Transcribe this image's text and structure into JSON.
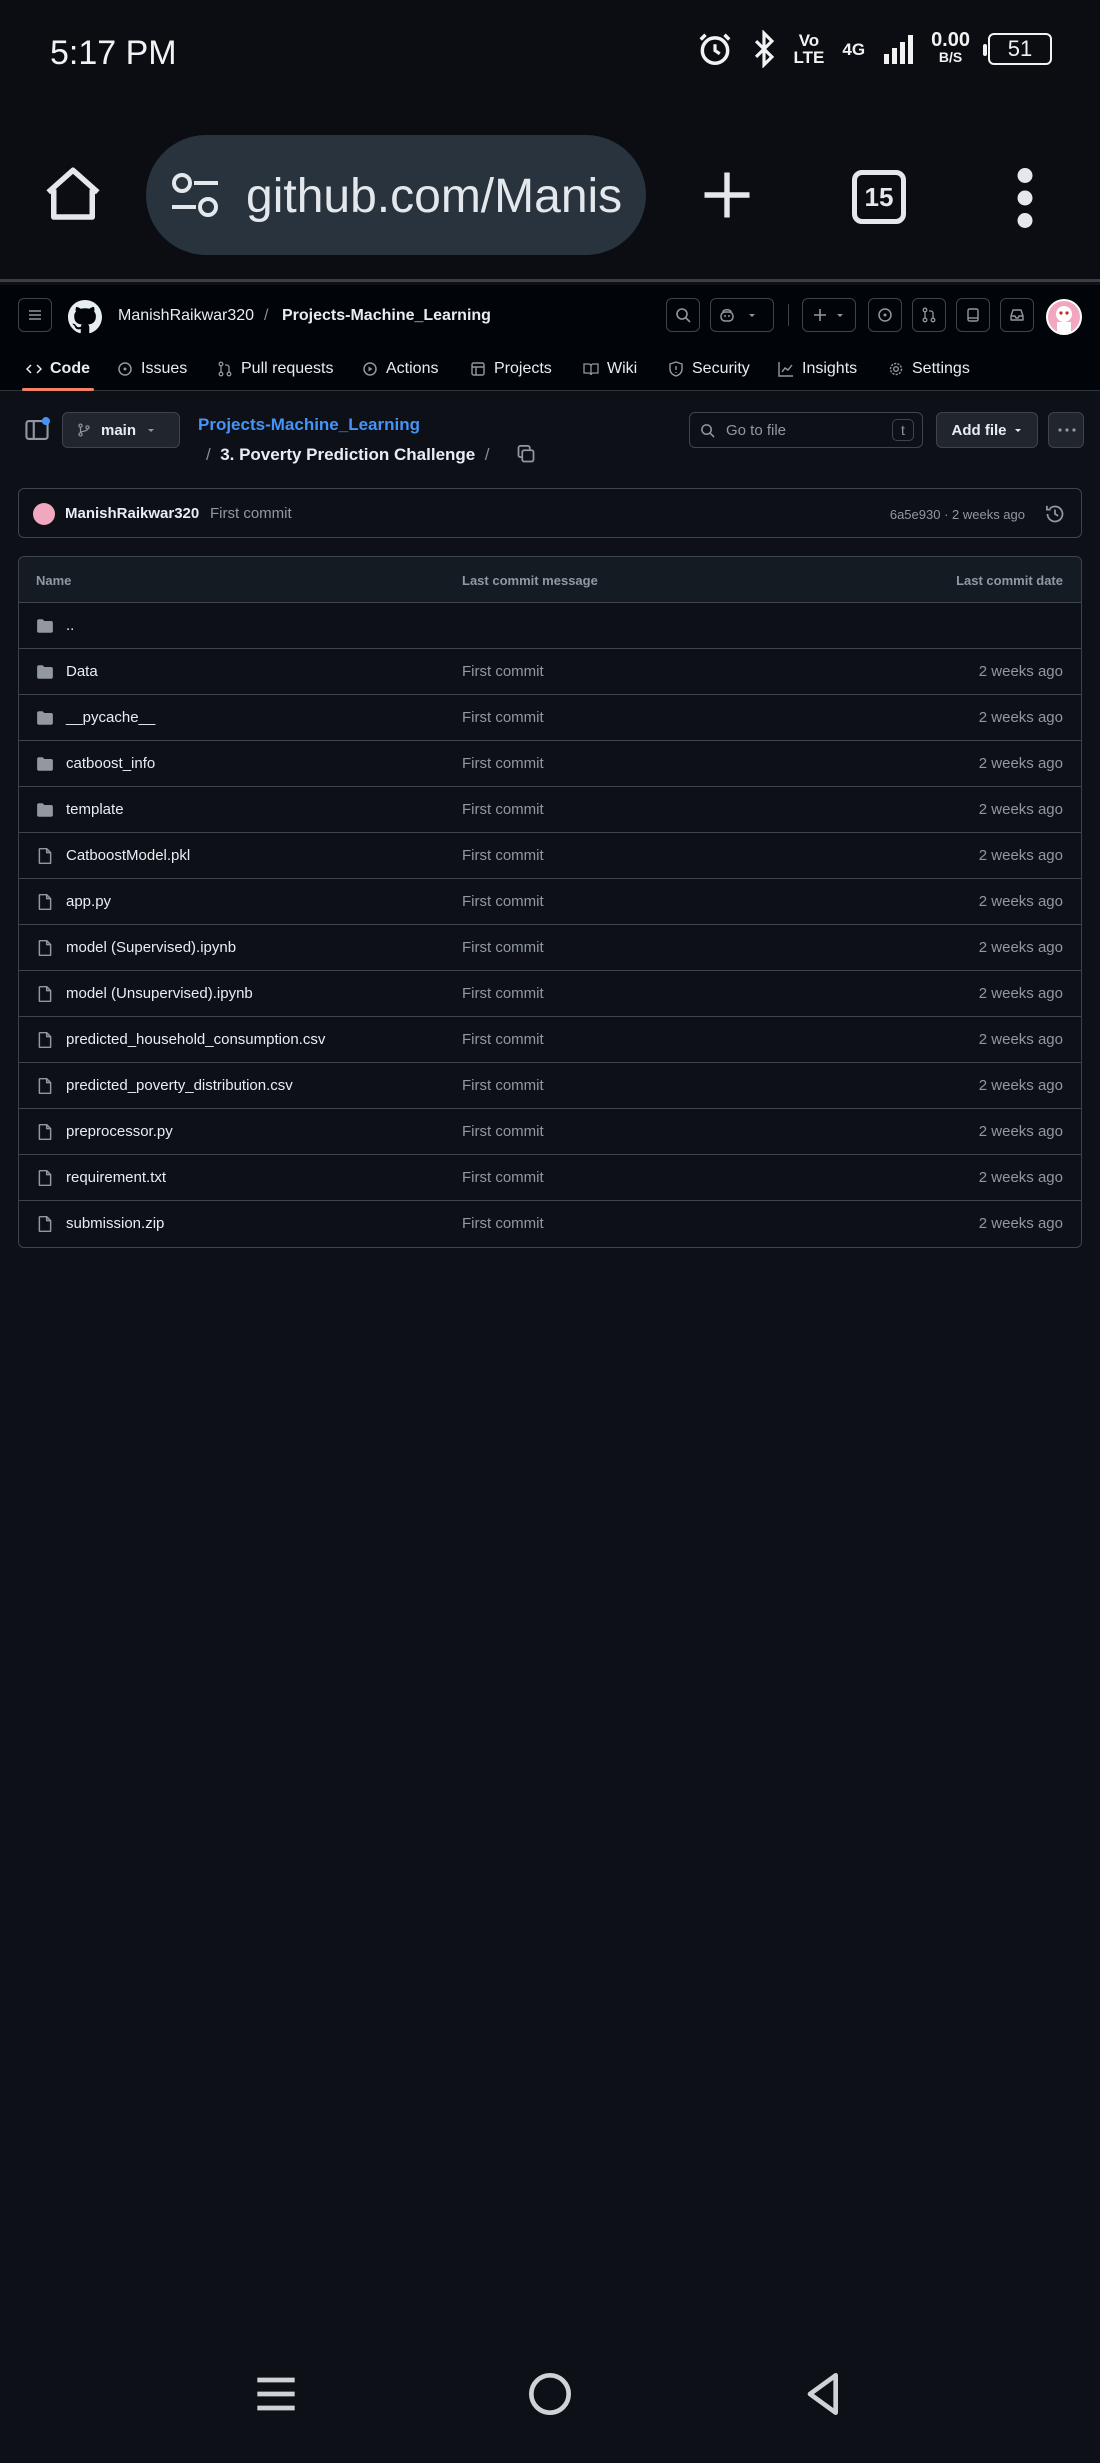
{
  "status_bar": {
    "time": "5:17 PM",
    "volte_top": "Vo",
    "volte_bottom": "LTE",
    "network": "4G",
    "data_speed": "0.00",
    "data_unit": "B/S",
    "battery": "51"
  },
  "browser": {
    "url": "github.com/Manis",
    "tab_count": "15"
  },
  "github_header": {
    "owner": "ManishRaikwar320",
    "separator": "/",
    "repo": "Projects-Machine_Learning"
  },
  "repo_tabs": [
    {
      "label": "Code",
      "icon": "code-icon"
    },
    {
      "label": "Issues",
      "icon": "issue-icon"
    },
    {
      "label": "Pull requests",
      "icon": "pull-request-icon"
    },
    {
      "label": "Actions",
      "icon": "play-icon"
    },
    {
      "label": "Projects",
      "icon": "table-icon"
    },
    {
      "label": "Wiki",
      "icon": "book-icon"
    },
    {
      "label": "Security",
      "icon": "shield-icon"
    },
    {
      "label": "Insights",
      "icon": "graph-icon"
    },
    {
      "label": "Settings",
      "icon": "gear-icon"
    }
  ],
  "file_nav": {
    "branch": "main",
    "path_repo": "Projects-Machine_Learning",
    "path_slash": "/",
    "path_dir": "3. Poverty Prediction Challenge",
    "path_trailing_slash": "/",
    "goto_placeholder": "Go to file",
    "goto_shortcut": "t",
    "add_file_label": "Add file"
  },
  "latest_commit": {
    "author": "ManishRaikwar320",
    "message": "First commit",
    "meta": "6a5e930 · 2 weeks ago"
  },
  "file_table": {
    "headers": {
      "name": "Name",
      "message": "Last commit message",
      "date": "Last commit date"
    },
    "parent_dir": "..",
    "rows": [
      {
        "name": "Data",
        "type": "folder",
        "message": "First commit",
        "date": "2 weeks ago"
      },
      {
        "name": "__pycache__",
        "type": "folder",
        "message": "First commit",
        "date": "2 weeks ago"
      },
      {
        "name": "catboost_info",
        "type": "folder",
        "message": "First commit",
        "date": "2 weeks ago"
      },
      {
        "name": "template",
        "type": "folder",
        "message": "First commit",
        "date": "2 weeks ago"
      },
      {
        "name": "CatboostModel.pkl",
        "type": "file",
        "message": "First commit",
        "date": "2 weeks ago"
      },
      {
        "name": "app.py",
        "type": "file",
        "message": "First commit",
        "date": "2 weeks ago"
      },
      {
        "name": "model (Supervised).ipynb",
        "type": "file",
        "message": "First commit",
        "date": "2 weeks ago"
      },
      {
        "name": "model (Unsupervised).ipynb",
        "type": "file",
        "message": "First commit",
        "date": "2 weeks ago"
      },
      {
        "name": "predicted_household_consumption.csv",
        "type": "file",
        "message": "First commit",
        "date": "2 weeks ago"
      },
      {
        "name": "predicted_poverty_distribution.csv",
        "type": "file",
        "message": "First commit",
        "date": "2 weeks ago"
      },
      {
        "name": "preprocessor.py",
        "type": "file",
        "message": "First commit",
        "date": "2 weeks ago"
      },
      {
        "name": "requirement.txt",
        "type": "file",
        "message": "First commit",
        "date": "2 weeks ago"
      },
      {
        "name": "submission.zip",
        "type": "file",
        "message": "First commit",
        "date": "2 weeks ago"
      }
    ]
  },
  "colors": {
    "background": "#0d1117",
    "header_bg": "#010409",
    "link_blue": "#4493f8",
    "active_tab_underline": "#f78166",
    "url_pill": "#28333d"
  }
}
